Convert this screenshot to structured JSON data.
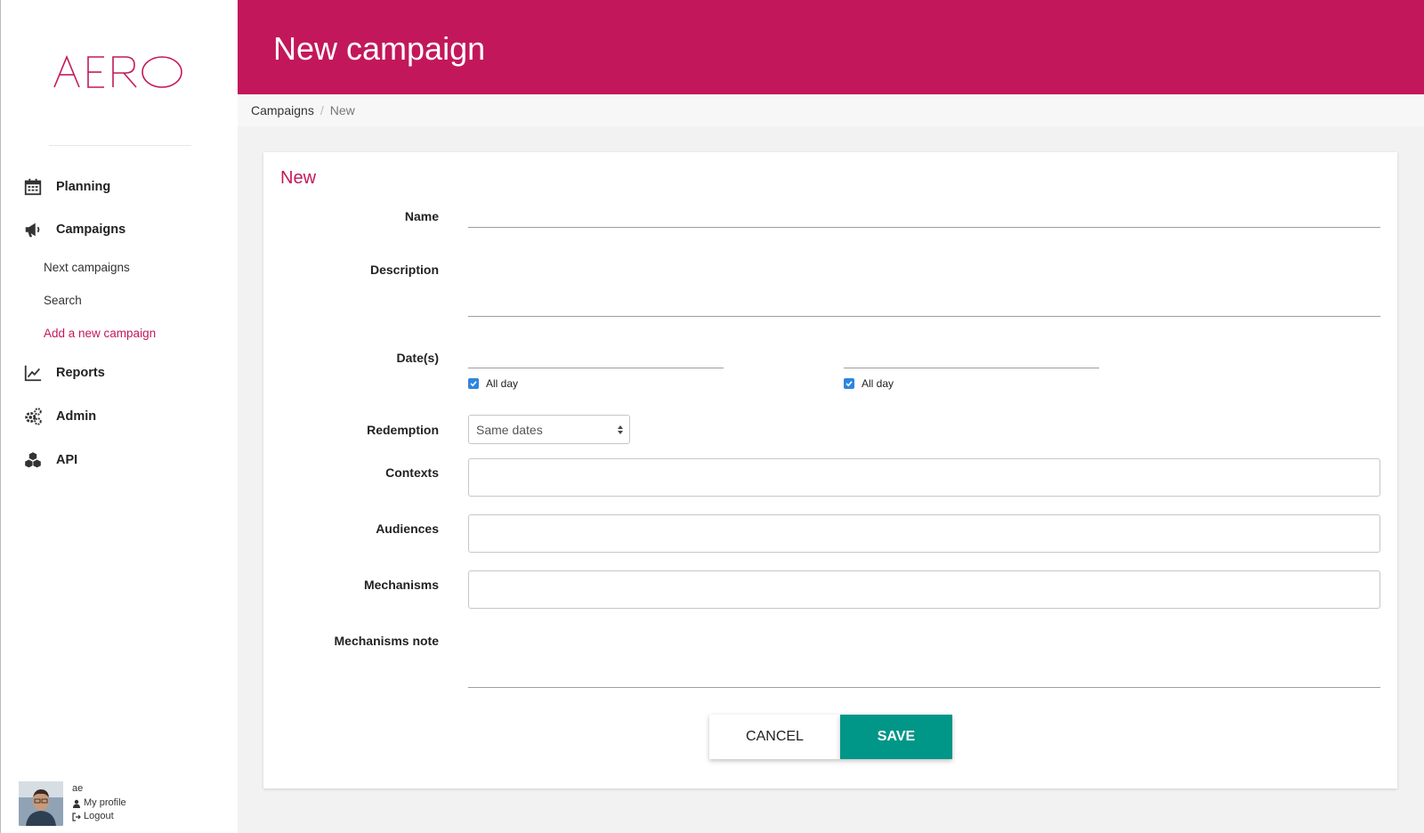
{
  "brand": {
    "logo_text": "AERO",
    "accent": "#c2185b",
    "save_color": "#009688",
    "checkbox_color": "#2e86de"
  },
  "sidebar": {
    "items": [
      {
        "label": "Planning",
        "icon": "calendar-icon"
      },
      {
        "label": "Campaigns",
        "icon": "megaphone-icon"
      },
      {
        "label": "Reports",
        "icon": "line-chart-icon"
      },
      {
        "label": "Admin",
        "icon": "gears-icon"
      },
      {
        "label": "API",
        "icon": "cubes-icon"
      }
    ],
    "campaign_subitems": [
      {
        "label": "Next campaigns"
      },
      {
        "label": "Search"
      },
      {
        "label": "Add a new campaign",
        "active": true
      }
    ],
    "user": {
      "name": "ae",
      "profile_label": "My profile",
      "logout_label": "Logout"
    }
  },
  "header": {
    "title": "New campaign"
  },
  "breadcrumb": {
    "items": [
      "Campaigns",
      "New"
    ]
  },
  "form": {
    "card_title": "New",
    "labels": {
      "name": "Name",
      "description": "Description",
      "dates": "Date(s)",
      "redemption": "Redemption",
      "contexts": "Contexts",
      "audiences": "Audiences",
      "mechanisms": "Mechanisms",
      "mechanisms_note": "Mechanisms note"
    },
    "values": {
      "name": "",
      "description": "",
      "date_start": "",
      "date_end": "",
      "mechanisms_note": ""
    },
    "all_day_label": "All day",
    "all_day_start_checked": true,
    "all_day_end_checked": true,
    "redemption_selected": "Same dates",
    "cancel_label": "CANCEL",
    "save_label": "SAVE"
  }
}
